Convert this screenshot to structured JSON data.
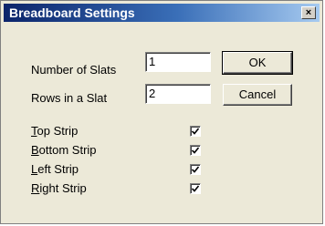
{
  "window": {
    "title": "Breadboard Settings",
    "close_glyph": "×"
  },
  "fields": [
    {
      "label": "Number of Slats",
      "value": "1"
    },
    {
      "label": "Rows in a Slat",
      "value": "2"
    }
  ],
  "buttons": {
    "ok": "OK",
    "cancel": "Cancel"
  },
  "strips": [
    {
      "mnemonic": "T",
      "rest": "op Strip",
      "checked": true
    },
    {
      "mnemonic": "B",
      "rest": "ottom Strip",
      "checked": true
    },
    {
      "mnemonic": "L",
      "rest": "eft Strip",
      "checked": true
    },
    {
      "mnemonic": "R",
      "rest": "ight Strip",
      "checked": true
    }
  ]
}
